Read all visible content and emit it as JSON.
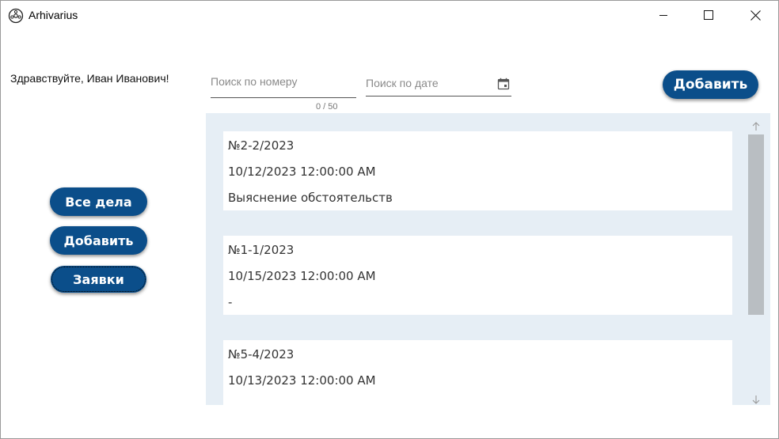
{
  "window": {
    "title": "Arhivarius"
  },
  "header": {
    "greeting": "Здравствуйте, Иван Иванович!",
    "search_number_placeholder": "Поиск по номеру",
    "search_number_counter": "0 / 50",
    "search_date_placeholder": "Поиск по дате",
    "add_button": "Добавить"
  },
  "sidebar": {
    "items": [
      {
        "label": "Все дела"
      },
      {
        "label": "Добавить"
      },
      {
        "label": "Заявки"
      }
    ]
  },
  "cases": [
    {
      "number": "№2-2/2023",
      "date": "10/12/2023 12:00:00 AM",
      "description": "Выяснение обстоятельств"
    },
    {
      "number": "№1-1/2023",
      "date": "10/15/2023 12:00:00 AM",
      "description": "-"
    },
    {
      "number": "№5-4/2023",
      "date": "10/13/2023 12:00:00 AM",
      "description": ""
    }
  ],
  "colors": {
    "accent": "#0b4e8a",
    "list_background": "#e6eef5",
    "scroll_thumb": "#b9bec2"
  }
}
